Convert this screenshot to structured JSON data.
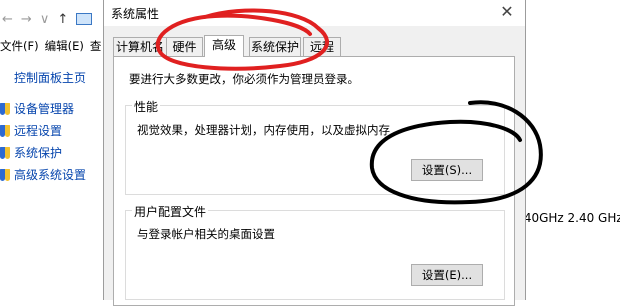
{
  "background_window": {
    "nav": {
      "back_glyph": "←",
      "forward_glyph": "→",
      "dropdown_glyph": "∨",
      "up_glyph": "↑"
    },
    "menu": [
      "文件(F)",
      "编辑(E)",
      "查"
    ],
    "control_panel_home": "控制面板主页",
    "sidebar_links": [
      "设备管理器",
      "远程设置",
      "系统保护",
      "高级系统设置"
    ],
    "processor_speed": ".40GHz   2.40 GHz"
  },
  "dialog": {
    "title": "系统属性",
    "close_glyph": "✕",
    "tabs": [
      "计算机名",
      "硬件",
      "高级",
      "系统保护",
      "远程"
    ],
    "active_tab": "高级",
    "notice": "要进行大多数更改，你必须作为管理员登录。",
    "performance": {
      "label": "性能",
      "description": "视觉效果，处理器计划，内存使用，以及虚拟内存",
      "button": "设置(S)..."
    },
    "user_profiles": {
      "label": "用户配置文件",
      "description": "与登录帐户相关的桌面设置",
      "button": "设置(E)..."
    }
  },
  "colors": {
    "red_annotation": "#e02020",
    "black_annotation": "#000000",
    "link": "#0645ad"
  },
  "icons": {
    "shield": "uac-shield-icon",
    "folder": "folder-icon"
  }
}
